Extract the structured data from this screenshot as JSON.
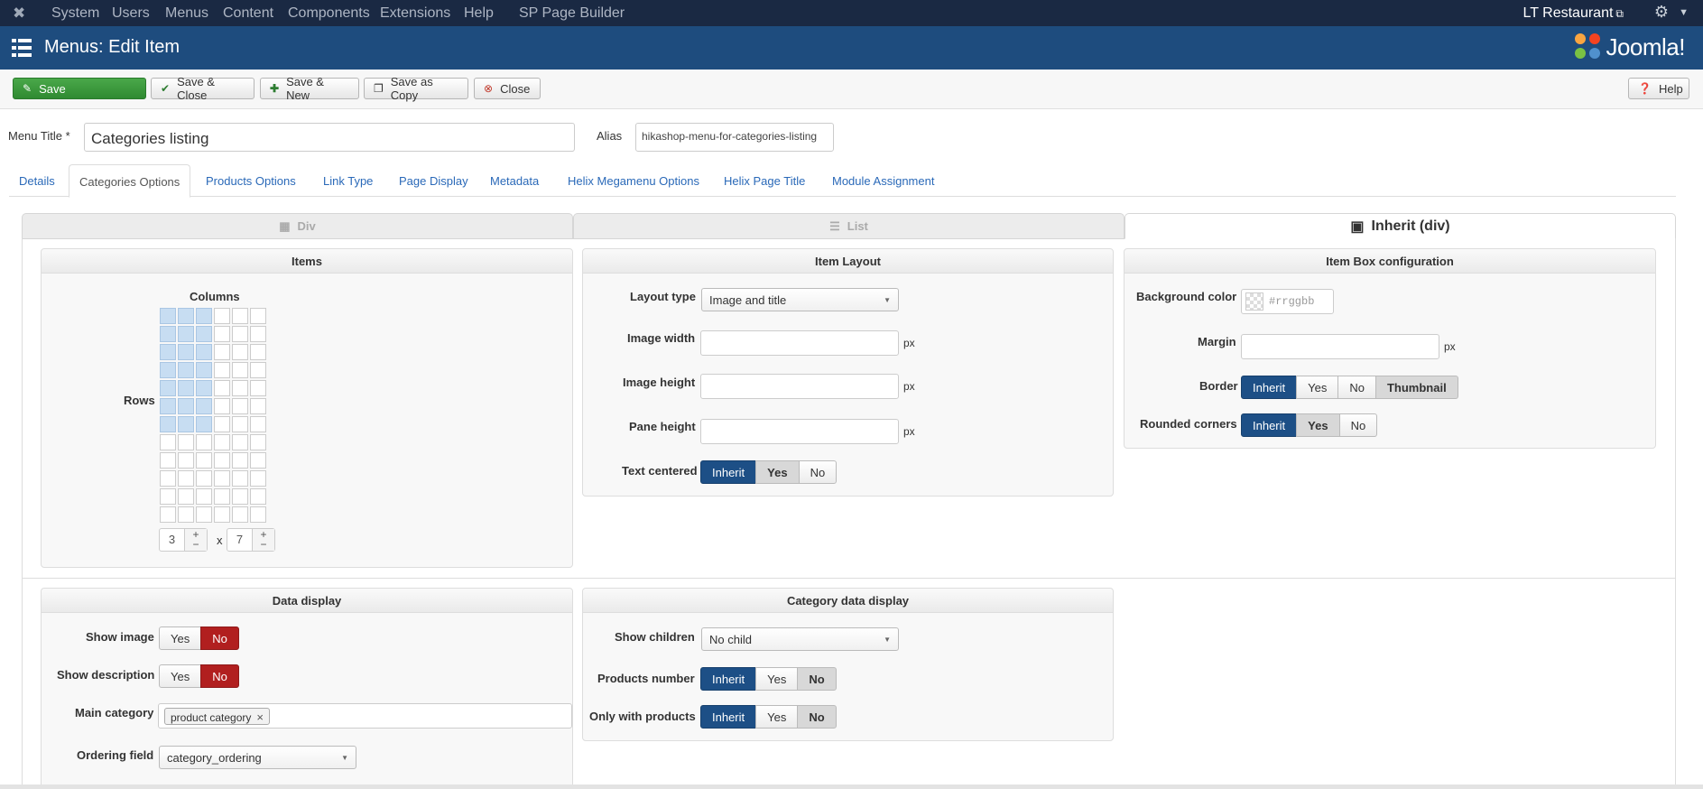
{
  "topbar": {
    "menu": [
      "System",
      "Users",
      "Menus",
      "Content",
      "Components",
      "Extensions",
      "Help",
      "SP Page Builder"
    ],
    "site_name": "LT Restaurant",
    "joomla_logo_icon": "joomla-x-icon",
    "settings_icon": "gear-icon"
  },
  "header": {
    "title": "Menus: Edit Item",
    "brand": "Joomla!"
  },
  "toolbar": {
    "save": "Save",
    "save_close": "Save & Close",
    "save_new": "Save & New",
    "save_copy": "Save as Copy",
    "close": "Close",
    "help": "Help"
  },
  "form": {
    "menu_title_label": "Menu Title *",
    "menu_title_value": "Categories listing",
    "alias_label": "Alias",
    "alias_value": "hikashop-menu-for-categories-listing"
  },
  "tabs": [
    "Details",
    "Categories Options",
    "Products Options",
    "Link Type",
    "Page Display",
    "Metadata",
    "Helix Megamenu Options",
    "Helix Page Title",
    "Module Assignment"
  ],
  "active_tab": "Categories Options",
  "layout_types": [
    "Div",
    "List",
    "Inherit (div)"
  ],
  "active_layout_type": "Inherit (div)",
  "items_panel": {
    "title": "Items",
    "columns_label": "Columns",
    "rows_label": "Rows",
    "columns_value": "3",
    "times": "x",
    "rows_value": "7"
  },
  "item_layout": {
    "title": "Item Layout",
    "layout_type_label": "Layout type",
    "layout_type_value": "Image and title",
    "image_width_label": "Image width",
    "image_height_label": "Image height",
    "pane_height_label": "Pane height",
    "unit": "px",
    "text_centered_label": "Text centered",
    "text_centered_options": [
      "Inherit",
      "Yes",
      "No"
    ]
  },
  "item_box": {
    "title": "Item Box configuration",
    "bg_color_label": "Background color",
    "bg_color_placeholder": "#rrggbb",
    "margin_label": "Margin",
    "unit": "px",
    "border_label": "Border",
    "border_options": [
      "Inherit",
      "Yes",
      "No",
      "Thumbnail"
    ],
    "rounded_label": "Rounded corners",
    "rounded_options": [
      "Inherit",
      "Yes",
      "No"
    ]
  },
  "data_display": {
    "title": "Data display",
    "show_image_label": "Show image",
    "show_description_label": "Show description",
    "yes": "Yes",
    "no": "No",
    "main_category_label": "Main category",
    "main_category_tag": "product category",
    "ordering_label": "Ordering field",
    "ordering_value": "category_ordering"
  },
  "category_data": {
    "title": "Category data display",
    "show_children_label": "Show children",
    "show_children_value": "No child",
    "products_number_label": "Products number",
    "only_products_label": "Only with products",
    "options": [
      "Inherit",
      "Yes",
      "No"
    ]
  },
  "colors": {
    "topbar_bg": "#1a2943",
    "header_bg": "#1e4c7e",
    "save_green": "#3c9a3e",
    "selected_blue": "#1d4f86",
    "no_red": "#b11f1f",
    "grid_selected": "#c7ddf2"
  }
}
